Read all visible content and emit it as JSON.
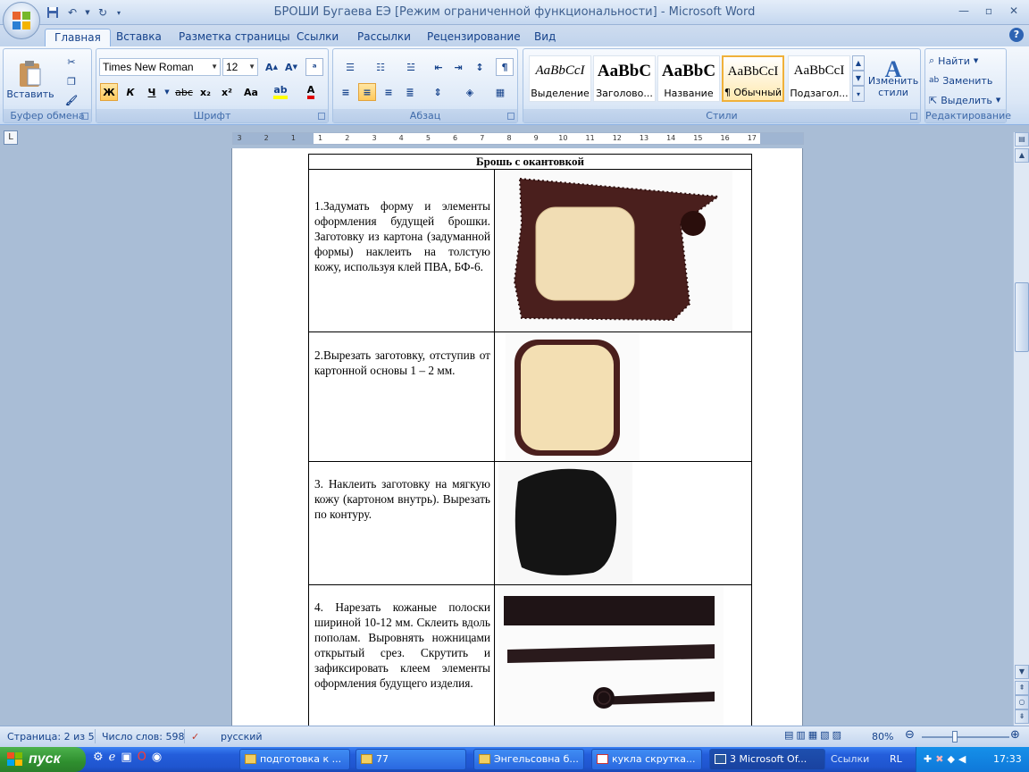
{
  "window": {
    "title": "БРОШИ Бугаева ЕЭ [Режим ограниченной функциональности] - Microsoft Word"
  },
  "tabs": [
    "Главная",
    "Вставка",
    "Разметка страницы",
    "Ссылки",
    "Рассылки",
    "Рецензирование",
    "Вид"
  ],
  "ribbon": {
    "clipboard": {
      "label": "Буфер обмена",
      "paste": "Вставить"
    },
    "font": {
      "label": "Шрифт",
      "name": "Times New Roman",
      "size": "12",
      "bold": "Ж",
      "italic": "К",
      "underline": "Ч",
      "strike": "abc",
      "sub": "x₂",
      "sup": "x²",
      "case": "Aa"
    },
    "paragraph": {
      "label": "Абзац"
    },
    "styles": {
      "label": "Стили",
      "items": [
        {
          "sample": "AaBbCcI",
          "name": "Выделение"
        },
        {
          "sample": "AaBbC",
          "name": "Заголово..."
        },
        {
          "sample": "AaBbC",
          "name": "Название"
        },
        {
          "sample": "AaBbCcI",
          "name": "¶ Обычный"
        },
        {
          "sample": "AaBbCcI",
          "name": "Подзагол..."
        }
      ],
      "change_line1": "Изменить",
      "change_line2": "стили"
    },
    "editing": {
      "label": "Редактирование",
      "find": "Найти",
      "replace": "Заменить",
      "select": "Выделить"
    }
  },
  "ruler": {
    "ticks": [
      "3",
      "2",
      "1",
      "1",
      "2",
      "3",
      "4",
      "5",
      "6",
      "7",
      "8",
      "9",
      "10",
      "11",
      "12",
      "13",
      "14",
      "15",
      "16",
      "17"
    ]
  },
  "document": {
    "table_title": "Брошь с окантовкой",
    "steps": [
      {
        "text": "1.Задумать форму и элементы оформления будущей брошки. Заготовку из картона (задуманной формы) наклеить на толстую кожу, используя клей ПВА, БФ-6."
      },
      {
        "text": "2.Вырезать заготовку, отступив от картонной основы 1 – 2 мм."
      },
      {
        "text": "3. Наклеить заготовку на мягкую кожу (картоном внутрь). Вырезать по контуру."
      },
      {
        "text": "4. Нарезать кожаные полоски шириной 10-12 мм. Склеить вдоль пополам. Выровнять ножницами открытый срез. Скрутить и зафиксировать клеем элементы оформления будущего изделия."
      }
    ]
  },
  "statusbar": {
    "page": "Страница: 2 из 5",
    "words": "Число слов: 598",
    "lang": "русский",
    "zoom": "80%"
  },
  "taskbar": {
    "start": "пуск",
    "buttons": [
      "подготовка к ...",
      "77",
      "Энгельсовна б...",
      "кукла скрутка...",
      "3 Microsoft Of..."
    ],
    "links": "Ссылки",
    "lang": "RL",
    "time": "17:33"
  }
}
